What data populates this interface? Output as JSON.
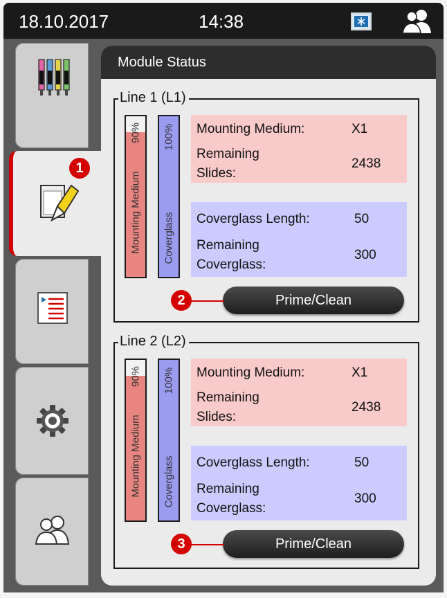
{
  "status_bar": {
    "date": "18.10.2017",
    "time": "14:38"
  },
  "panel": {
    "title": "Module Status"
  },
  "lines": [
    {
      "title": "Line 1 (L1)",
      "mounting_bar": {
        "label": "Mounting Medium",
        "percent_label": "90%",
        "fill": 0.9,
        "color": "#e88580"
      },
      "coverglass_bar": {
        "label": "Coverglass",
        "percent_label": "100%",
        "fill": 1.0,
        "color": "#9b9bf0"
      },
      "mounting_info": {
        "medium_label": "Mounting Medium:",
        "medium_value": "X1",
        "slides_label_1": "Remaining",
        "slides_label_2": "Slides:",
        "slides_value": "2438"
      },
      "coverglass_info": {
        "length_label": "Coverglass Length:",
        "length_value": "50",
        "remaining_label_1": "Remaining",
        "remaining_label_2": "Coverglass:",
        "remaining_value": "300"
      },
      "button": "Prime/Clean",
      "callout": "2"
    },
    {
      "title": "Line 2 (L2)",
      "mounting_bar": {
        "label": "Mounting Medium",
        "percent_label": "90%",
        "fill": 0.9,
        "color": "#e88580"
      },
      "coverglass_bar": {
        "label": "Coverglass",
        "percent_label": "100%",
        "fill": 1.0,
        "color": "#9b9bf0"
      },
      "mounting_info": {
        "medium_label": "Mounting Medium:",
        "medium_value": "X1",
        "slides_label_1": "Remaining",
        "slides_label_2": "Slides:",
        "slides_value": "2438"
      },
      "coverglass_info": {
        "length_label": "Coverglass Length:",
        "length_value": "50",
        "remaining_label_1": "Remaining",
        "remaining_label_2": "Coverglass:",
        "remaining_value": "300"
      },
      "button": "Prime/Clean",
      "callout": "3"
    }
  ],
  "sidebar_callout": "1",
  "colors": {
    "mounting_panel": "#f8caca",
    "coverglass_panel": "#cbcbff",
    "callout": "#d40000"
  },
  "sidebar": [
    "reagents-icon",
    "module-status-icon",
    "protocol-list-icon",
    "settings-icon",
    "user-icon"
  ]
}
